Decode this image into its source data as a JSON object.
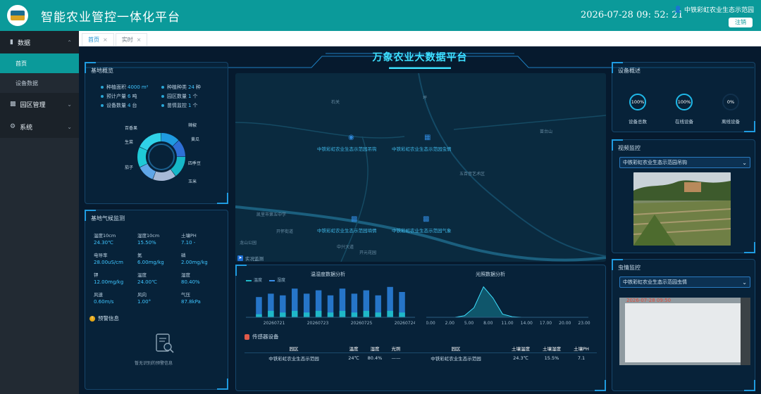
{
  "app": {
    "title": "智能农业管控一体化平台",
    "clock": "2026-07-28 09: 52: 21",
    "user": "中铁彩虹农业生态示范园",
    "logout": "注销"
  },
  "sidebar": {
    "groups": [
      {
        "label": "数据",
        "items": [
          {
            "label": "首页",
            "active": true
          },
          {
            "label": "设备数据",
            "active": false
          }
        ]
      },
      {
        "label": "园区管理"
      },
      {
        "label": "系统"
      }
    ]
  },
  "tabs": [
    {
      "label": "首页",
      "active": true
    },
    {
      "label": "实时",
      "active": false
    }
  ],
  "dashboard": {
    "title": "万象农业大数据平台"
  },
  "base": {
    "title": "基地概览",
    "info": [
      {
        "k": "种植面积",
        "v": "4000",
        "u": "m²"
      },
      {
        "k": "种植种类",
        "v": "24",
        "u": "种"
      },
      {
        "k": "预计产量",
        "v": "6",
        "u": "吨"
      },
      {
        "k": "园区数量",
        "v": "1",
        "u": "个"
      },
      {
        "k": "设备数量",
        "v": "4",
        "u": "台"
      },
      {
        "k": "苗情监控",
        "v": "1",
        "u": "个"
      }
    ],
    "donut": {
      "labels": [
        "百香果",
        "生菜",
        "茄子",
        "辣椒",
        "黄瓜",
        "四季豆",
        "玉米"
      ],
      "values": [
        13,
        12,
        15,
        16,
        12,
        14,
        18
      ],
      "colors": [
        "#1f9be0",
        "#2f6fd6",
        "#16b7c8",
        "#a7b9d6",
        "#5fa6e8",
        "#1fc9d6",
        "#30d2e8"
      ]
    }
  },
  "weather": {
    "title": "基地气候监测",
    "items": [
      {
        "k": "温度10cm",
        "v": "24.30℃"
      },
      {
        "k": "湿度10cm",
        "v": "15.50%"
      },
      {
        "k": "土壤PH",
        "v": "7.10 -"
      },
      {
        "k": "电导率",
        "v": "28.00uS/cm"
      },
      {
        "k": "氮",
        "v": "6.00mg/kg"
      },
      {
        "k": "磷",
        "v": "2.00mg/kg"
      },
      {
        "k": "钾",
        "v": "12.00mg/kg"
      },
      {
        "k": "温度",
        "v": "24.00℃"
      },
      {
        "k": "湿度",
        "v": "80.40%"
      },
      {
        "k": "风速",
        "v": "0.60m/s"
      },
      {
        "k": "风向",
        "v": "1.00°"
      },
      {
        "k": "气压",
        "v": "87.8kPa"
      }
    ],
    "warn": "预警信息",
    "empty": "暂无识别的预警信息"
  },
  "map": {
    "labels": [
      "中铁彩虹农业生态示范园吊钩",
      "中铁彩虹农业生态示范园虫情",
      "中铁彩虹农业生态示范园墒情",
      "中铁彩虹农业生态示范园气象"
    ],
    "cities": [
      "石关",
      "坪",
      "苗台山",
      "五百音艺术区",
      "凯里市第五中学",
      "开怀街道",
      "龙山公园",
      "开元花园",
      "中兴大道"
    ],
    "sense": "实况监测"
  },
  "chart_data": [
    {
      "type": "bar",
      "title": "温湿度数据分析",
      "series": [
        {
          "name": "温度",
          "values": [
            1,
            3,
            2,
            3,
            2,
            3,
            2,
            3,
            2,
            3,
            2,
            3,
            2
          ]
        },
        {
          "name": "湿度",
          "values": [
            12,
            14,
            13,
            17,
            14,
            16,
            13,
            17,
            14,
            16,
            13,
            18,
            15
          ]
        }
      ],
      "tick_labels": [
        "20260721",
        "20260723",
        "20260725",
        "20260724"
      ]
    },
    {
      "type": "area",
      "title": "光照数据分析",
      "x": [
        "0.00",
        "2.00",
        "5.00",
        "8.00",
        "11.00",
        "14.00",
        "17.00",
        "20.00",
        "23.00"
      ],
      "y": [
        0,
        0,
        0,
        0,
        5,
        30,
        95,
        60,
        10,
        2,
        0,
        0,
        0,
        0,
        0,
        0,
        0,
        0
      ]
    }
  ],
  "sensor": {
    "title": "传感器设备",
    "headers": [
      "园区",
      "温度",
      "湿度",
      "光照",
      "园区",
      "土壤温度",
      "土壤湿度",
      "土壤PH"
    ],
    "row": [
      "中铁彩虹农业生态示范园",
      "24℃",
      "80.4%",
      "——",
      "中铁彩虹农业生态示范园",
      "24.3℃",
      "15.5%",
      "7.1"
    ]
  },
  "devices": {
    "title": "设备概述",
    "items": [
      {
        "k": "设备总数",
        "v": "100%"
      },
      {
        "k": "在线设备",
        "v": "100%"
      },
      {
        "k": "离线设备",
        "v": "0%"
      }
    ]
  },
  "video": {
    "title": "视频监控",
    "option": "中铁彩虹农业生态示范园吊钩"
  },
  "pest": {
    "title": "虫情监控",
    "option": "中铁彩虹农业生态示范园虫情",
    "stamp": "2026-07-28 09:50"
  }
}
